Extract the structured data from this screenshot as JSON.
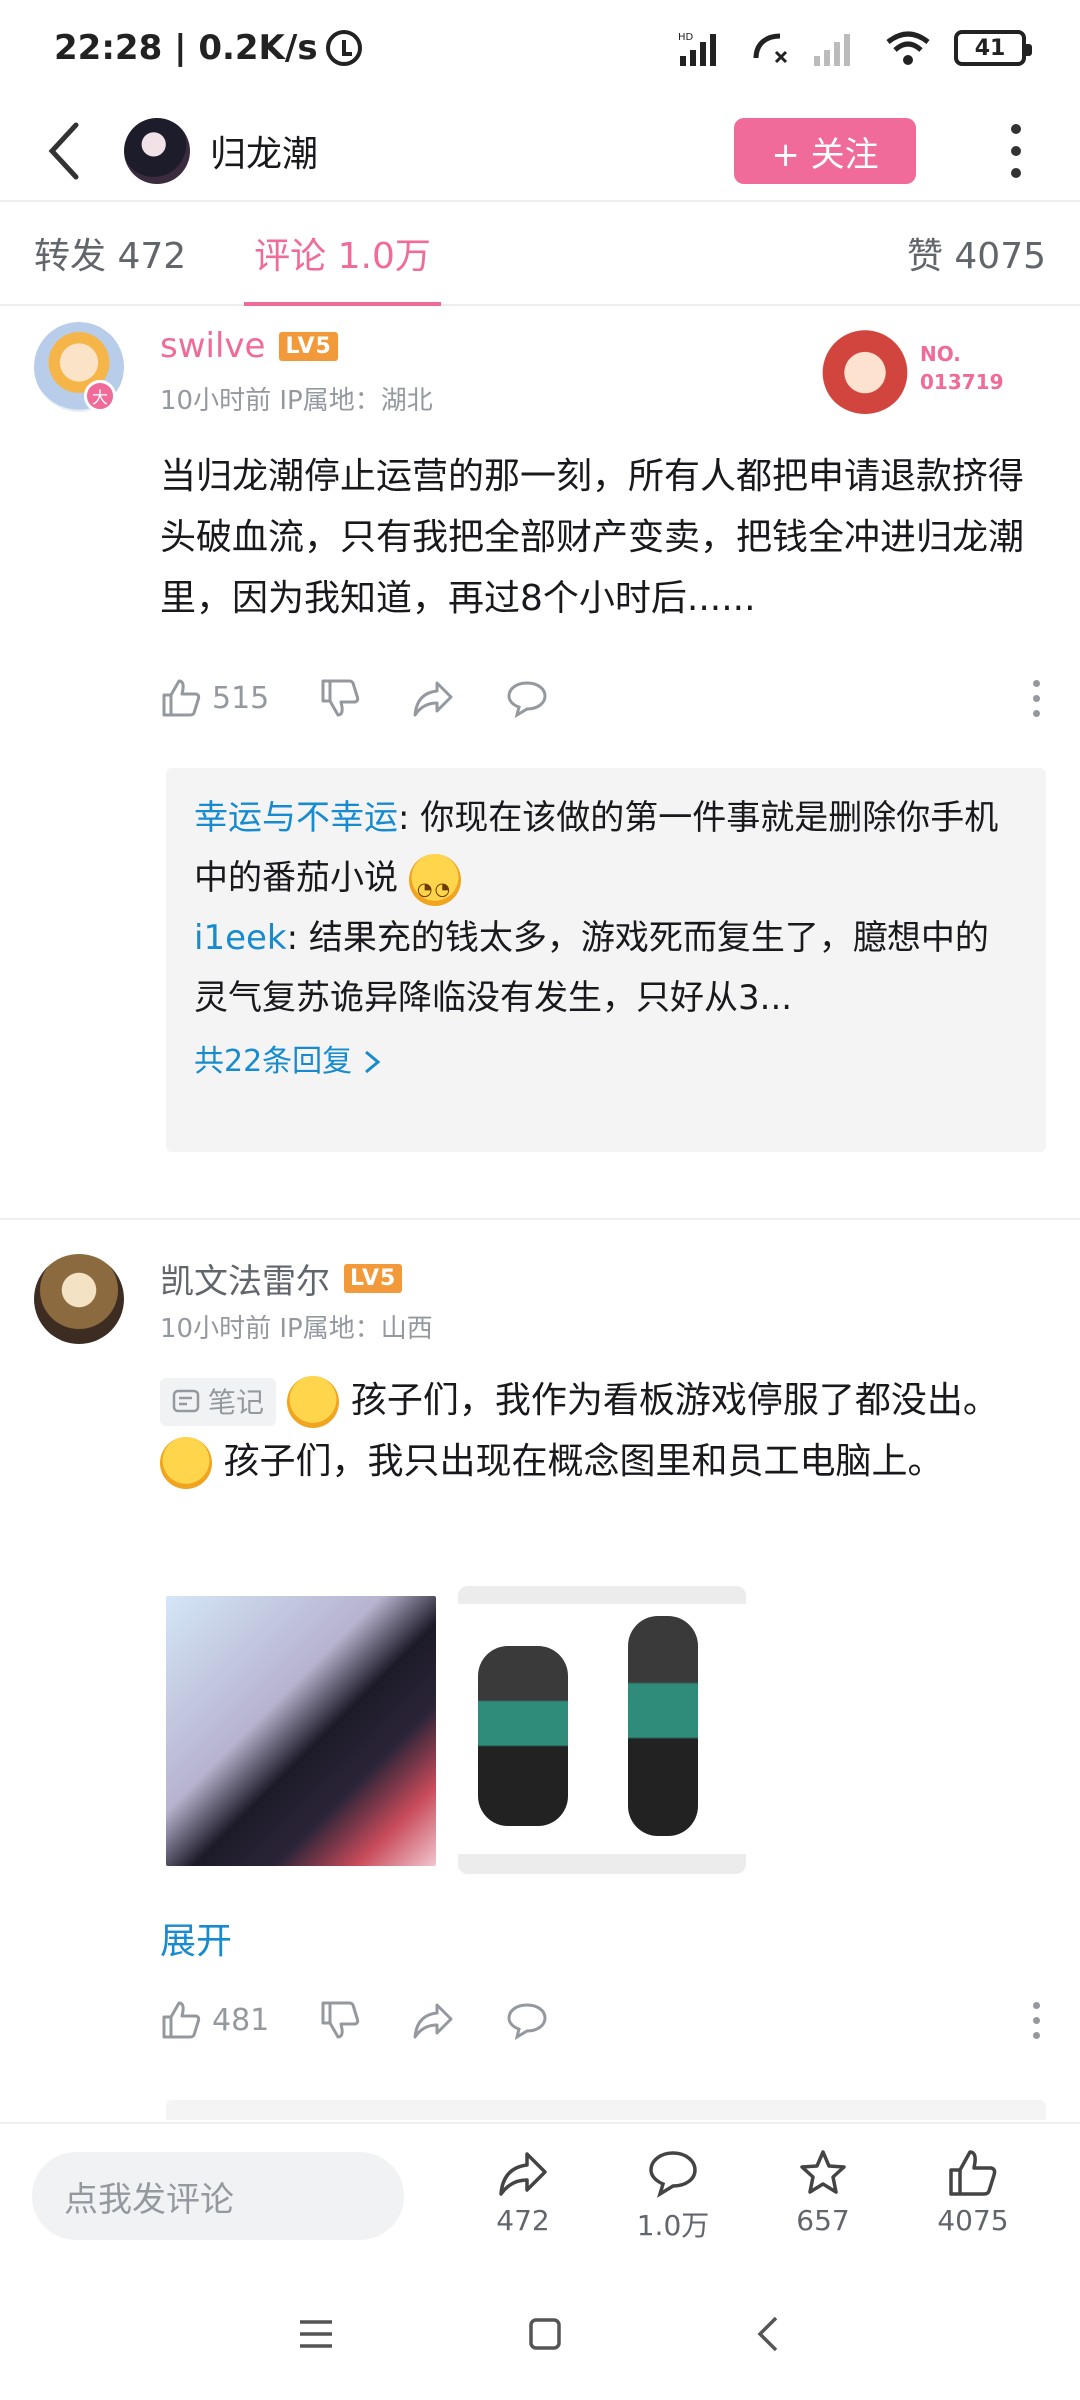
{
  "status_bar": {
    "time_speed": "22:28 | 0.2K/s",
    "battery": "41"
  },
  "header": {
    "title": "归龙潮",
    "follow_label": "+ 关注"
  },
  "tabs": {
    "repost": "转发 472",
    "comments": "评论 1.0万",
    "likes": "赞 4075"
  },
  "comments": [
    {
      "user": "swilve",
      "level": "LV5",
      "meta": "10小时前  IP属地：湖北",
      "badge_no": "NO.",
      "badge_num": "013719",
      "text": "当归龙潮停止运营的那一刻，所有人都把申请退款挤得头破血流，只有我把全部财产变卖，把钱全冲进归龙潮里，因为我知道，再过8个小时后......",
      "likes": "515",
      "replies": [
        {
          "user": "幸运与不幸运",
          "text": ": 你现在该做的第一件事就是删除你手机中的番茄小说"
        },
        {
          "user": "i1eek",
          "text": ": 结果充的钱太多，游戏死而复生了，臆想中的灵气复苏诡异降临没有发生，只好从3..."
        }
      ],
      "reply_more": "共22条回复"
    },
    {
      "user": "凯文法雷尔",
      "level": "LV5",
      "meta": "10小时前  IP属地：山西",
      "note_tag": "笔记",
      "text_line1": "孩子们，我作为看板游戏停服了都没出。",
      "text_line2": "孩子们，我只出现在概念图里和员工电脑上。",
      "expand": "展开",
      "likes": "481"
    }
  ],
  "bottom_bar": {
    "placeholder": "点我发评论",
    "share_count": "472",
    "comment_count": "1.0万",
    "fav_count": "657",
    "like_count": "4075"
  }
}
